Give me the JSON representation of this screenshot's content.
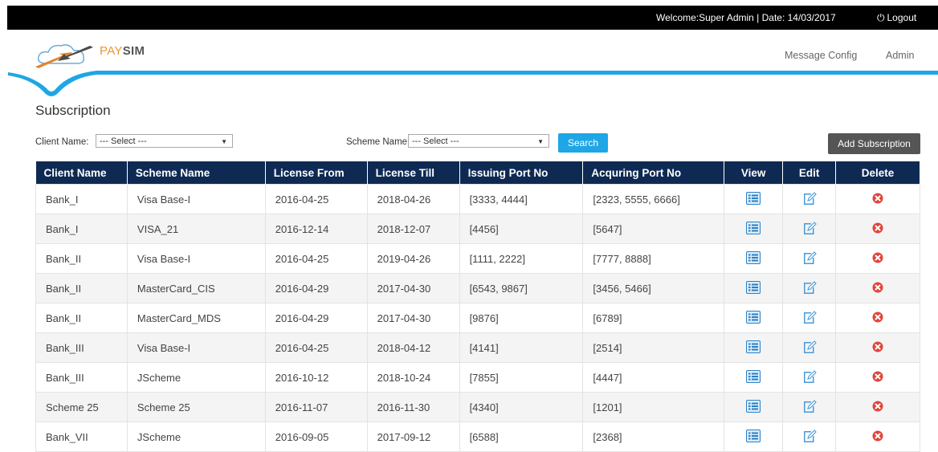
{
  "topbar": {
    "welcome": "Welcome:Super Admin  |  Date: 14/03/2017",
    "logout_label": "Logout"
  },
  "brand": {
    "pay": "PAY",
    "sim": "SIM"
  },
  "nav": {
    "message_config": "Message Config",
    "admin": "Admin"
  },
  "page": {
    "title": "Subscription"
  },
  "filters": {
    "client_label": "Client Name:",
    "client_selected": "--- Select ---",
    "scheme_label": "Scheme Name:",
    "scheme_selected": "--- Select ---",
    "search_button": "Search",
    "add_button": "Add Subscription"
  },
  "colors": {
    "topbar": "#000000",
    "header_row": "#0e2a53",
    "accent_blue": "#1ea6e6",
    "add_button": "#555555",
    "delete_icon": "#e0443a"
  },
  "table": {
    "headers": [
      "Client Name",
      "Scheme Name",
      "License From",
      "License Till",
      "Issuing Port No",
      "Acquring Port No",
      "View",
      "Edit",
      "Delete"
    ],
    "rows": [
      [
        "Bank_I",
        "Visa Base-I",
        "2016-04-25",
        "2018-04-26",
        "[3333, 4444]",
        "[2323, 5555, 6666]"
      ],
      [
        "Bank_I",
        "VISA_21",
        "2016-12-14",
        "2018-12-07",
        "[4456]",
        "[5647]"
      ],
      [
        "Bank_II",
        "Visa Base-I",
        "2016-04-25",
        "2019-04-26",
        "[1111, 2222]",
        "[7777, 8888]"
      ],
      [
        "Bank_II",
        "MasterCard_CIS",
        "2016-04-29",
        "2017-04-30",
        "[6543, 9867]",
        "[3456, 5466]"
      ],
      [
        "Bank_II",
        "MasterCard_MDS",
        "2016-04-29",
        "2017-04-30",
        "[9876]",
        "[6789]"
      ],
      [
        "Bank_III",
        "Visa Base-I",
        "2016-04-25",
        "2018-04-12",
        "[4141]",
        "[2514]"
      ],
      [
        "Bank_III",
        "JScheme",
        "2016-10-12",
        "2018-10-24",
        "[7855]",
        "[4447]"
      ],
      [
        "Scheme 25",
        "Scheme 25",
        "2016-11-07",
        "2016-11-30",
        "[4340]",
        "[1201]"
      ],
      [
        "Bank_VII",
        "JScheme",
        "2016-09-05",
        "2017-09-12",
        "[6588]",
        "[2368]"
      ]
    ],
    "row_icons": {
      "view": "list-view-icon",
      "edit": "edit-pencil-icon",
      "delete": "delete-x-icon"
    }
  }
}
